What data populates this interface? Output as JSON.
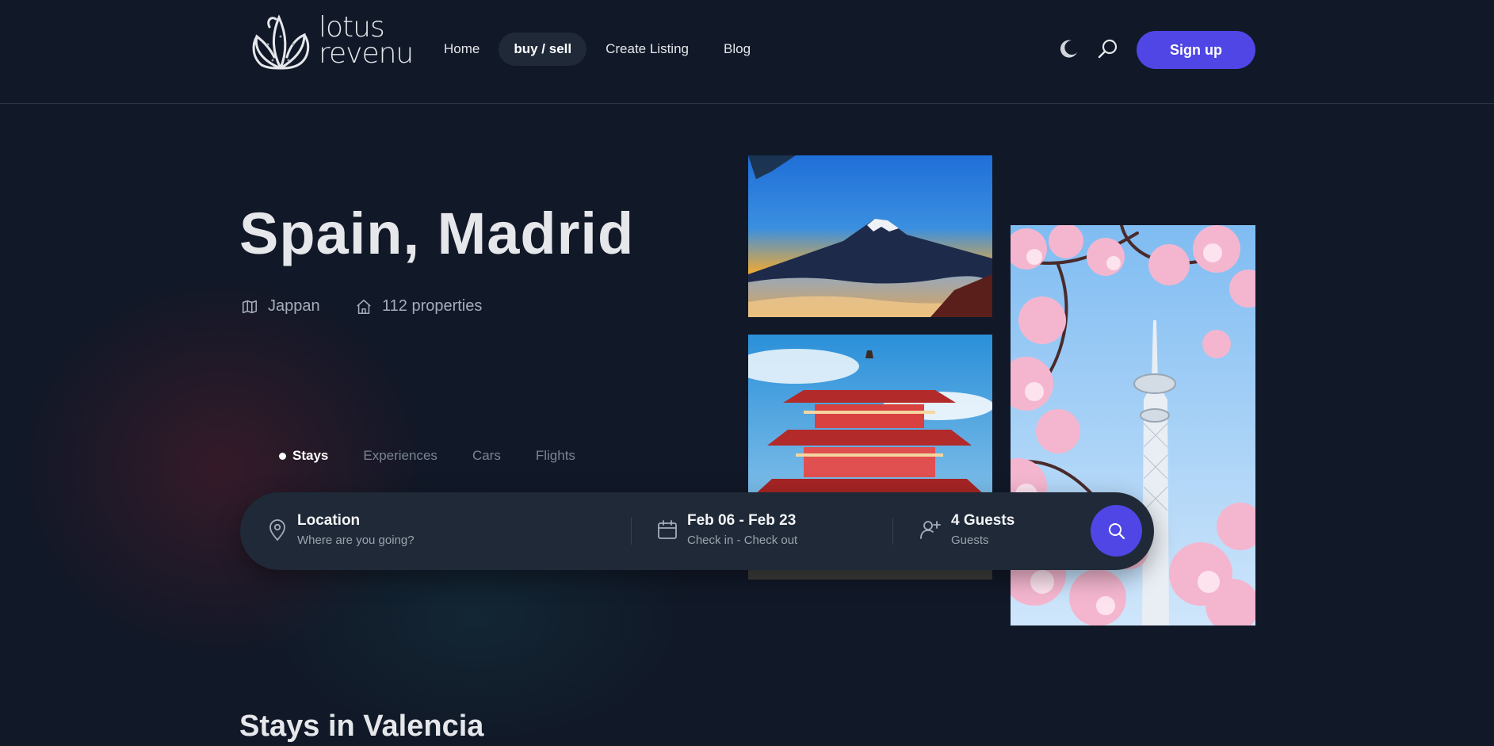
{
  "brand": {
    "line1": "lotus",
    "line2": "revenu"
  },
  "nav": [
    {
      "label": "Home",
      "active": false
    },
    {
      "label": "buy / sell",
      "active": true
    },
    {
      "label": "Create Listing",
      "active": false
    },
    {
      "label": "Blog",
      "active": false
    }
  ],
  "header": {
    "signup_label": "Sign up",
    "theme_icon": "moon-icon",
    "search_icon": "search-icon"
  },
  "hero": {
    "title": "Spain, Madrid",
    "country": "Jappan",
    "properties": "112 properties"
  },
  "tabs": [
    {
      "label": "Stays",
      "active": true
    },
    {
      "label": "Experiences",
      "active": false
    },
    {
      "label": "Cars",
      "active": false
    },
    {
      "label": "Flights",
      "active": false
    }
  ],
  "search": {
    "location_title": "Location",
    "location_placeholder": "Where are you going?",
    "dates_title": "Feb 06 - Feb 23",
    "dates_sub": "Check in - Check out",
    "guests_title": "4 Guests",
    "guests_sub": "Guests"
  },
  "section": {
    "title": "Stays in Valencia"
  },
  "colors": {
    "accent": "#4f46e5",
    "background": "#111827",
    "surface": "#1f2937"
  }
}
